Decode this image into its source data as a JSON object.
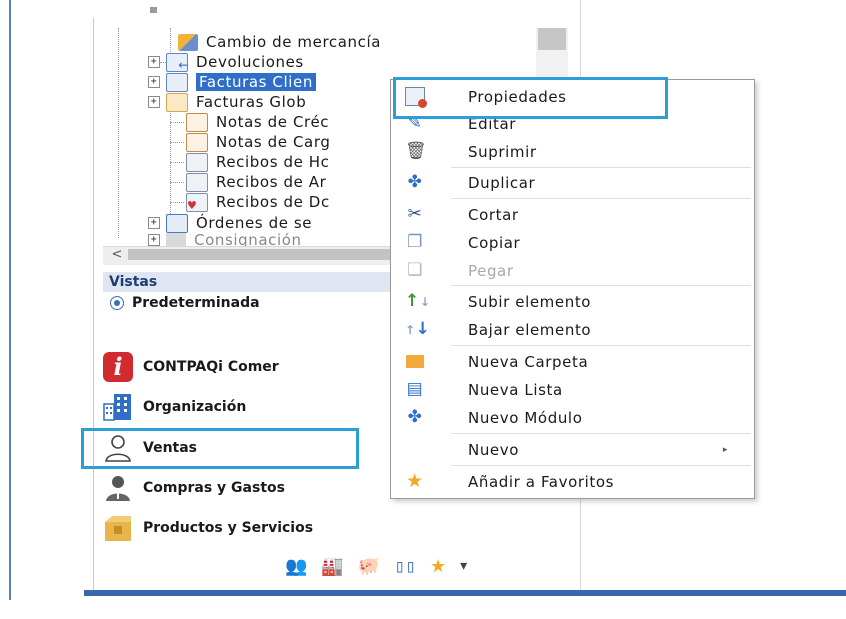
{
  "tree": {
    "items": [
      {
        "label": "Cambio de mercancía",
        "icon": "exchange-icon"
      },
      {
        "label": "Devoluciones",
        "icon": "return-document-icon"
      },
      {
        "label": "Facturas Clien",
        "icon": "invoice-icon"
      },
      {
        "label": "Facturas Glob",
        "icon": "global-invoice-icon"
      },
      {
        "label": "Notas de Créc",
        "icon": "credit-note-icon"
      },
      {
        "label": "Notas de Carg",
        "icon": "charge-note-icon"
      },
      {
        "label": "Recibos de Hc",
        "icon": "receipt-icon"
      },
      {
        "label": "Recibos de Ar",
        "icon": "receipt-icon"
      },
      {
        "label": "Recibos de Dc",
        "icon": "receipt-icon"
      },
      {
        "label": "Órdenes de se",
        "icon": "service-order-icon"
      },
      {
        "label": "Consignación",
        "icon": "folder-icon"
      }
    ],
    "scroll_left_glyph": "<"
  },
  "vistas": {
    "header": "Vistas",
    "selected": "Predeterminada"
  },
  "modules": [
    {
      "label": "CONTPAQi Comer",
      "icon": "contpaqi-logo-icon"
    },
    {
      "label": "Organización",
      "icon": "organization-icon"
    },
    {
      "label": "Ventas",
      "icon": "sales-person-icon"
    },
    {
      "label": "Compras y Gastos",
      "icon": "purchases-person-icon"
    },
    {
      "label": "Productos y Servicios",
      "icon": "products-box-icon"
    }
  ],
  "bottom_toolbar": {
    "icons": [
      "people-icon",
      "factory-icon",
      "piggy-bank-icon",
      "columns-icon",
      "star-icon",
      "dropdown-icon"
    ]
  },
  "context_menu": {
    "items": [
      {
        "label": "Propiedades",
        "icon": "properties-icon",
        "enabled": true
      },
      {
        "label": "Editar",
        "icon": "edit-icon",
        "enabled": true
      },
      {
        "label": "Suprimir",
        "icon": "trash-icon",
        "enabled": true
      },
      {
        "label": "Duplicar",
        "icon": "duplicate-puzzle-icon",
        "enabled": true
      },
      {
        "label": "Cortar",
        "icon": "scissors-icon",
        "enabled": true
      },
      {
        "label": "Copiar",
        "icon": "copy-icon",
        "enabled": true
      },
      {
        "label": "Pegar",
        "icon": "paste-icon",
        "enabled": false
      },
      {
        "label": "Subir elemento",
        "icon": "move-up-icon",
        "enabled": true
      },
      {
        "label": "Bajar elemento",
        "icon": "move-down-icon",
        "enabled": true
      },
      {
        "label": "Nueva Carpeta",
        "icon": "folder-icon",
        "enabled": true
      },
      {
        "label": "Nueva Lista",
        "icon": "list-icon",
        "enabled": true
      },
      {
        "label": "Nuevo Módulo",
        "icon": "puzzle-icon",
        "enabled": true
      },
      {
        "label": "Nuevo",
        "icon": "",
        "enabled": true,
        "submenu_arrow": "▸"
      },
      {
        "label": "Añadir a Favoritos",
        "icon": "star-icon",
        "enabled": true
      }
    ]
  },
  "colors": {
    "accent_highlight": "#2b9fd5",
    "selection": "#2f6fc7",
    "frame_blue": "#3a66ad"
  }
}
